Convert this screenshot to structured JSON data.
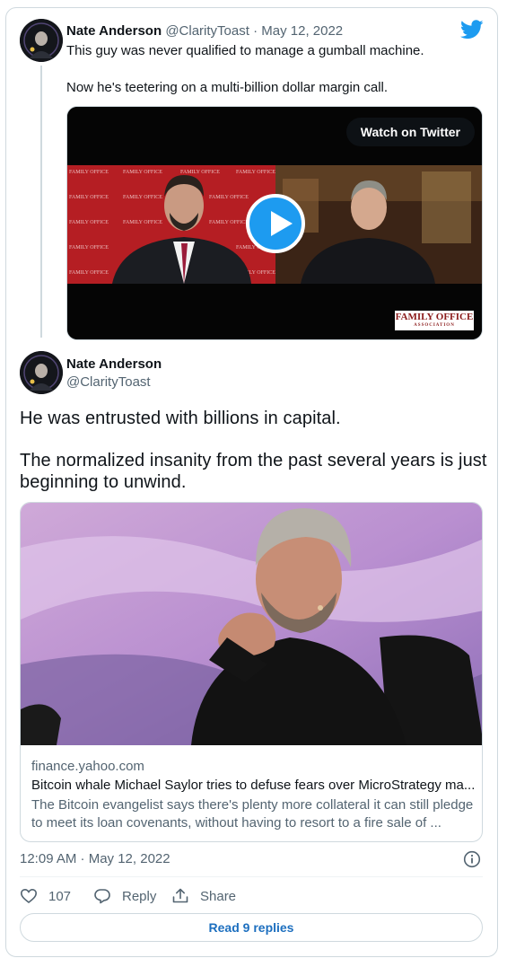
{
  "quoted_tweet": {
    "author_name": "Nate Anderson",
    "author_handle": "@ClarityToast",
    "date": "May 12, 2022",
    "line1": "This guy was never qualified to manage a gumball machine.",
    "line2": "Now he's teetering on a multi-billion dollar margin call.",
    "video": {
      "watch_label": "Watch on Twitter",
      "logo_main": "FAMILY OFFICE",
      "logo_sub": "ASSOCIATION",
      "backdrop_text": "FAMILY OFFICE"
    }
  },
  "tweet": {
    "author_name": "Nate Anderson",
    "author_handle": "@ClarityToast",
    "text_line1": "He was entrusted with billions in capital.",
    "text_line2": "The normalized insanity from the past several years is just",
    "text_line3": "beginning to unwind.",
    "link_card": {
      "domain": "finance.yahoo.com",
      "title": "Bitcoin whale Michael Saylor tries to defuse fears over MicroStrategy ma...",
      "desc_line1": "The Bitcoin evangelist says there's plenty more collateral it can still pledge",
      "desc_line2": "to meet its loan covenants, without having to resort to a fire sale of ..."
    },
    "timestamp": "12:09 AM · May 12, 2022",
    "actions": {
      "likes": "107",
      "reply_label": "Reply",
      "share_label": "Share"
    },
    "read_replies_label": "Read 9 replies"
  },
  "colors": {
    "twitter_blue": "#1d9bf0",
    "secondary_text": "#536471",
    "border": "#cfd9de"
  },
  "icons": [
    "twitter-bird-icon",
    "play-icon",
    "info-icon",
    "heart-icon",
    "reply-bubble-icon",
    "share-icon"
  ]
}
